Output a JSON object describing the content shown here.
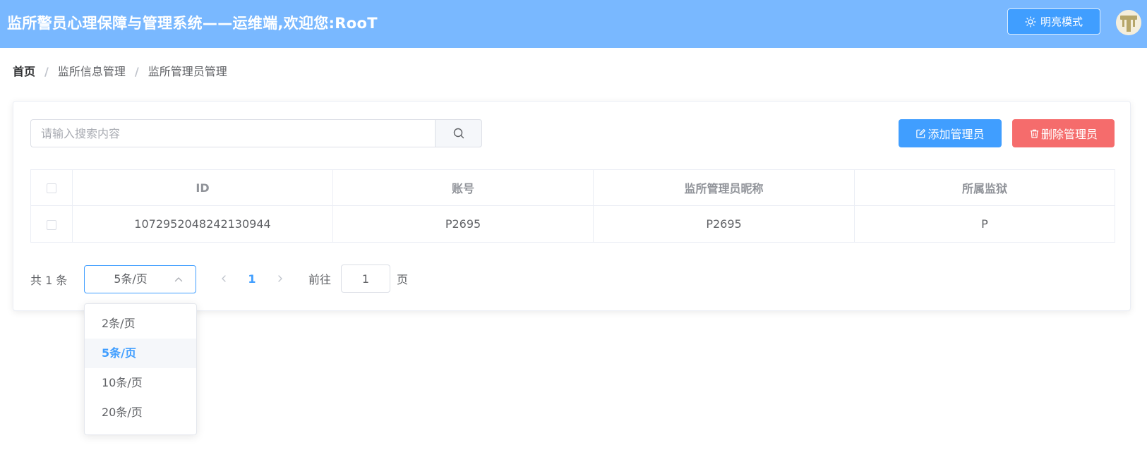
{
  "header": {
    "title": "监所警员心理保障与管理系统——运维端,欢迎您:RooT",
    "theme_button_label": "明亮模式",
    "theme_icon": "sun-icon",
    "avatar_icon": "user-avatar-icon"
  },
  "breadcrumb": {
    "items": [
      "首页",
      "监所信息管理",
      "监所管理员管理"
    ],
    "separator": "/"
  },
  "toolbar": {
    "search_placeholder": "请输入搜索内容",
    "search_icon": "search-icon",
    "add_label": "添加管理员",
    "add_icon": "edit-icon",
    "delete_label": "删除管理员",
    "delete_icon": "trash-icon"
  },
  "table": {
    "columns": [
      "ID",
      "账号",
      "监所管理员昵称",
      "所属监狱"
    ],
    "rows": [
      [
        "1072952048242130944",
        "P2695",
        "P2695",
        "P"
      ]
    ]
  },
  "pagination": {
    "total_label": "共 1 条",
    "page_size_value": "5条/页",
    "current_page": "1",
    "goto_label": "前往",
    "goto_value": "1",
    "page_suffix": "页"
  },
  "page_size_dropdown": {
    "options": [
      "2条/页",
      "5条/页",
      "10条/页",
      "20条/页"
    ],
    "selected": "5条/页"
  },
  "colors": {
    "header_bg": "#79b8ff",
    "primary": "#409eff",
    "danger": "#f56c6c",
    "text": "#606266",
    "header_text": "#909399"
  }
}
